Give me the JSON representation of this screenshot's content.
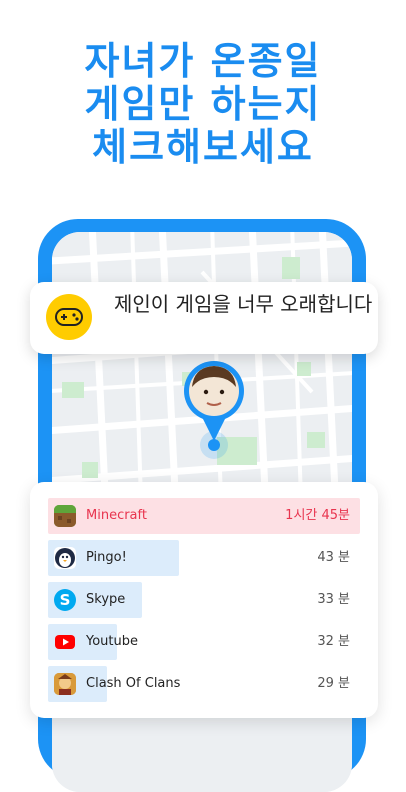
{
  "headline": {
    "lines": [
      "자녀가 온종일",
      "게임만 하는지",
      "체크해보세요"
    ],
    "color": "#1a8cf0"
  },
  "alert": {
    "message": "제인이 게임을 너무 오래합니다",
    "icon": "gamepad-icon",
    "icon_bg": "#ffcc00"
  },
  "apps": [
    {
      "name": "Minecraft",
      "time": "1시간 45분",
      "icon": "minecraft-icon",
      "usage_fraction": 1.0,
      "highlight": true
    },
    {
      "name": "Pingo!",
      "time": "43 분",
      "icon": "pingo-icon",
      "usage_fraction": 0.42,
      "highlight": false
    },
    {
      "name": "Skype",
      "time": "33 분",
      "icon": "skype-icon",
      "usage_fraction": 0.3,
      "highlight": false
    },
    {
      "name": "Youtube",
      "time": "32 분",
      "icon": "youtube-icon",
      "usage_fraction": 0.22,
      "highlight": false
    },
    {
      "name": "Clash Of Clans",
      "time": "29 분",
      "icon": "clash-of-clans-icon",
      "usage_fraction": 0.19,
      "highlight": false
    }
  ],
  "colors": {
    "accent": "#1c93f5",
    "highlight_bar": "#fde0e4",
    "usage_bar": "#dcecfb",
    "alert_red": "#e8344e"
  }
}
